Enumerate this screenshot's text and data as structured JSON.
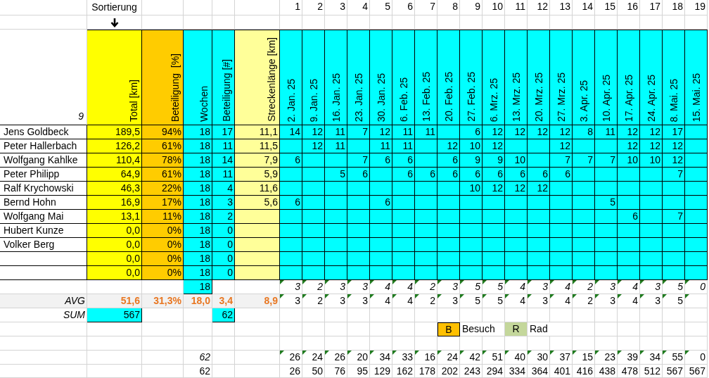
{
  "sort_label": "Sortierung",
  "week_numbers": [
    "1",
    "2",
    "3",
    "4",
    "5",
    "6",
    "7",
    "8",
    "9",
    "10",
    "11",
    "12",
    "13",
    "14",
    "15",
    "16",
    "17",
    "18",
    "19"
  ],
  "corner_label": "9",
  "columns": [
    "Total [km]",
    "Beteiligung  [%]",
    "Wochen",
    "Beteiligung [#]",
    "Streckenlänge [km]"
  ],
  "weeks": [
    "2. Jan. 25",
    "9. Jan. 25",
    "16. Jan. 25",
    "23. Jan. 25",
    "30. Jan. 25",
    "6. Feb. 25",
    "13. Feb. 25",
    "20. Feb. 25",
    "27. Feb. 25",
    "6. Mrz. 25",
    "13. Mrz. 25",
    "20. Mrz. 25",
    "27. Mrz. 25",
    "3. Apr. 25",
    "10. Apr. 25",
    "17. Apr. 25",
    "24. Apr. 25",
    "8. Mai. 25",
    "15. Mai. 25"
  ],
  "participants": [
    {
      "name": "Jens Goldbeck",
      "total": "189,5",
      "share": "94%",
      "weeks": "18",
      "count": "17",
      "distance": "11,1",
      "rides": {
        "w1": "14",
        "w2": "12",
        "w3": "11",
        "w4": "7",
        "w5": "12",
        "w6": "11",
        "w7": "11",
        "w9": "6",
        "w10": "12",
        "w11": "12",
        "w12": "12",
        "w13": "12",
        "w14": "8",
        "w15": "11",
        "w16": "12",
        "w17": "12",
        "w18": "17"
      }
    },
    {
      "name": "Peter Hallerbach",
      "total": "126,2",
      "share": "61%",
      "weeks": "18",
      "count": "11",
      "distance": "11,5",
      "rides": {
        "w2": "12",
        "w3": "11",
        "w5": "11",
        "w6": "11",
        "w8": "12",
        "w9": "10",
        "w10": "12",
        "w13": "12",
        "w16": "12",
        "w17": "12",
        "w18": "12"
      }
    },
    {
      "name": "Wolfgang Kahlke",
      "total": "110,4",
      "share": "78%",
      "weeks": "18",
      "count": "14",
      "distance": "7,9",
      "rides": {
        "w1": "6",
        "w4": "7",
        "w5": "6",
        "w6": "6",
        "w8": "6",
        "w9": "9",
        "w10": "9",
        "w11": "10",
        "w13": "7",
        "w14": "7",
        "w15": "7",
        "w16": "10",
        "w17": "10",
        "w18": "12"
      }
    },
    {
      "name": "Peter Philipp",
      "total": "64,9",
      "share": "61%",
      "weeks": "18",
      "count": "11",
      "distance": "5,9",
      "rides": {
        "w3": "5",
        "w4": "6",
        "w6": "6",
        "w7": "6",
        "w8": "6",
        "w9": "6",
        "w10": "6",
        "w11": "6",
        "w12": "6",
        "w13": "6",
        "w18": "7"
      }
    },
    {
      "name": "Ralf Krychowski",
      "total": "46,3",
      "share": "22%",
      "weeks": "18",
      "count": "4",
      "distance": "11,6",
      "rides": {
        "w9": "10",
        "w10": "12",
        "w11": "12",
        "w12": "12"
      }
    },
    {
      "name": "Bernd Hohn",
      "total": "16,9",
      "share": "17%",
      "weeks": "18",
      "count": "3",
      "distance": "5,6",
      "rides": {
        "w1": "6",
        "w5": "6",
        "w15": "5"
      }
    },
    {
      "name": "Wolfgang Mai",
      "total": "13,1",
      "share": "11%",
      "weeks": "18",
      "count": "2",
      "rides": {
        "w16": "6",
        "w18": "7"
      }
    },
    {
      "name": "Hubert Kunze",
      "total": "0,0",
      "share": "0%",
      "weeks": "18",
      "count": "0"
    },
    {
      "name": "Volker Berg",
      "total": "0,0",
      "share": "0%",
      "weeks": "18",
      "count": "0"
    },
    {
      "total": "0,0",
      "share": "0%",
      "weeks": "18",
      "count": "0"
    },
    {
      "total": "0,0",
      "share": "0%",
      "weeks": "18",
      "count": "0"
    }
  ],
  "weeks_row": {
    "weeks": "18",
    "flagged": true,
    "values": [
      "3",
      "2",
      "3",
      "3",
      "4",
      "4",
      "2",
      "3",
      "5",
      "5",
      "4",
      "3",
      "4",
      "2",
      "3",
      "4",
      "3",
      "5",
      "0"
    ]
  },
  "avg": {
    "label": "AVG",
    "total": "51,6",
    "share": "31,3%",
    "weeks": "18,0",
    "count": "3,4",
    "distance": "8,9",
    "flagged": true,
    "values": [
      "3",
      "2",
      "3",
      "3",
      "4",
      "4",
      "2",
      "3",
      "5",
      "5",
      "4",
      "3",
      "4",
      "2",
      "3",
      "4",
      "3",
      "5"
    ]
  },
  "sum": {
    "label": "SUM",
    "total": "567",
    "count": "62"
  },
  "legend": [
    {
      "key": "B",
      "label": "Besuch",
      "color": "#ffc000"
    },
    {
      "key": "R",
      "label": "Rad",
      "color": "#c4d79b"
    }
  ],
  "weekly_km": {
    "total": "62",
    "flagged": true,
    "values": [
      "26",
      "24",
      "26",
      "20",
      "34",
      "33",
      "16",
      "24",
      "42",
      "51",
      "40",
      "30",
      "37",
      "15",
      "23",
      "39",
      "34",
      "55",
      "0"
    ]
  },
  "cumulative_km": {
    "total": "62",
    "values": [
      "26",
      "50",
      "76",
      "95",
      "129",
      "162",
      "178",
      "202",
      "243",
      "294",
      "334",
      "364",
      "401",
      "416",
      "438",
      "478",
      "512",
      "567",
      "567"
    ]
  }
}
